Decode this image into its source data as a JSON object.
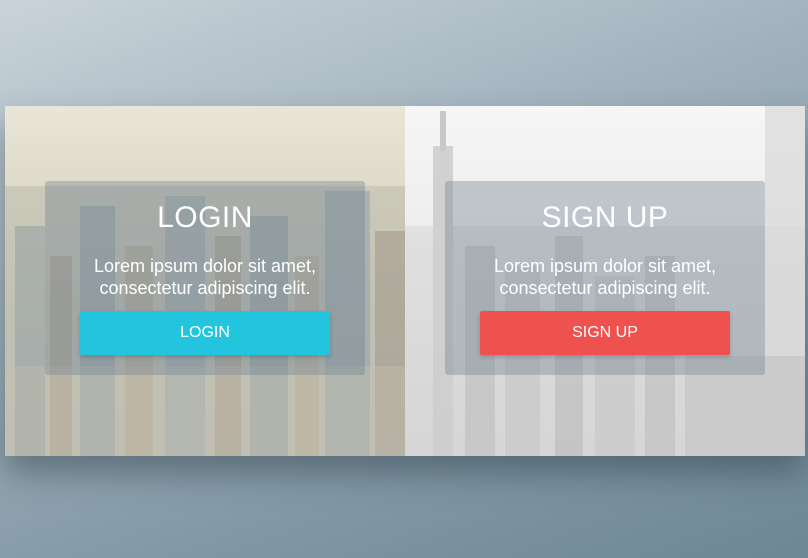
{
  "colors": {
    "login_button": "#22c5dd",
    "signup_button": "#ef524e",
    "card_overlay": "rgba(110,130,145,0.38)"
  },
  "login": {
    "title": "LOGIN",
    "description": "Lorem ipsum dolor sit amet, consectetur adipiscing elit.",
    "button_label": "LOGIN"
  },
  "signup": {
    "title": "SIGN UP",
    "description": "Lorem ipsum dolor sit amet, consectetur adipiscing elit.",
    "button_label": "SIGN UP"
  }
}
